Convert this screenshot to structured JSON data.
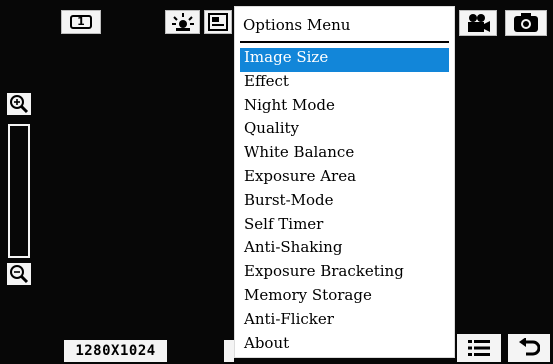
{
  "camera_ui": {
    "counter_label": "1",
    "resolution_label": "1280X1024",
    "icons": {
      "white_balance": "white-balance-sun-icon",
      "scene": "scene-mode-icon",
      "video": "video-camera-icon",
      "camera": "camera-icon",
      "zoom_in": "zoom-in-icon",
      "zoom_out": "zoom-out-icon",
      "menu": "list-menu-icon",
      "back": "back-arrow-icon"
    }
  },
  "options_menu": {
    "title": "Options Menu",
    "selected_index": 0,
    "items": [
      {
        "label": "Image Size"
      },
      {
        "label": "Effect"
      },
      {
        "label": "Night Mode"
      },
      {
        "label": "Quality"
      },
      {
        "label": "White Balance"
      },
      {
        "label": "Exposure Area"
      },
      {
        "label": "Burst-Mode"
      },
      {
        "label": "Self Timer"
      },
      {
        "label": "Anti-Shaking"
      },
      {
        "label": "Exposure Bracketing"
      },
      {
        "label": "Memory Storage"
      },
      {
        "label": "Anti-Flicker"
      },
      {
        "label": "About"
      }
    ]
  },
  "colors": {
    "selection": "#1286d9",
    "background": "#070707",
    "button": "#f4f4f4"
  }
}
